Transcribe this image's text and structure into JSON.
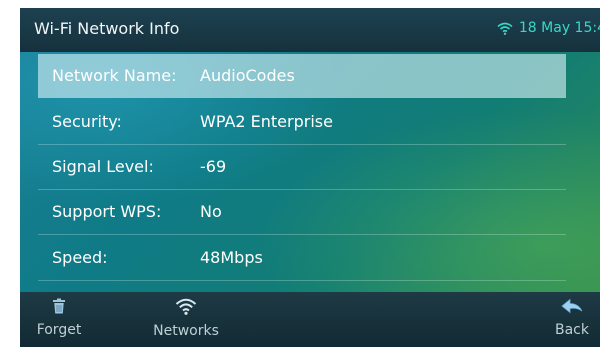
{
  "status_bar": {
    "title": "Wi-Fi Network Info",
    "date_time": "18 May 15:4",
    "wifi_icon": "wifi-signal-icon"
  },
  "colors": {
    "accent": "#39d8c6",
    "selected_row": "#cfe9ee",
    "softkey_bar": "#16313d"
  },
  "rows": [
    {
      "label": "Network Name:",
      "value": "AudioCodes",
      "selected": true
    },
    {
      "label": "Security:",
      "value": "WPA2 Enterprise"
    },
    {
      "label": "Signal Level:",
      "value": "-69"
    },
    {
      "label": "Support WPS:",
      "value": "No"
    },
    {
      "label": "Speed:",
      "value": "48Mbps"
    }
  ],
  "softkeys": [
    {
      "label": "Forget",
      "icon": "trash-icon"
    },
    {
      "label": "Networks",
      "icon": "wifi-icon"
    },
    {
      "label": "Back",
      "icon": "back-arrow-icon"
    }
  ]
}
